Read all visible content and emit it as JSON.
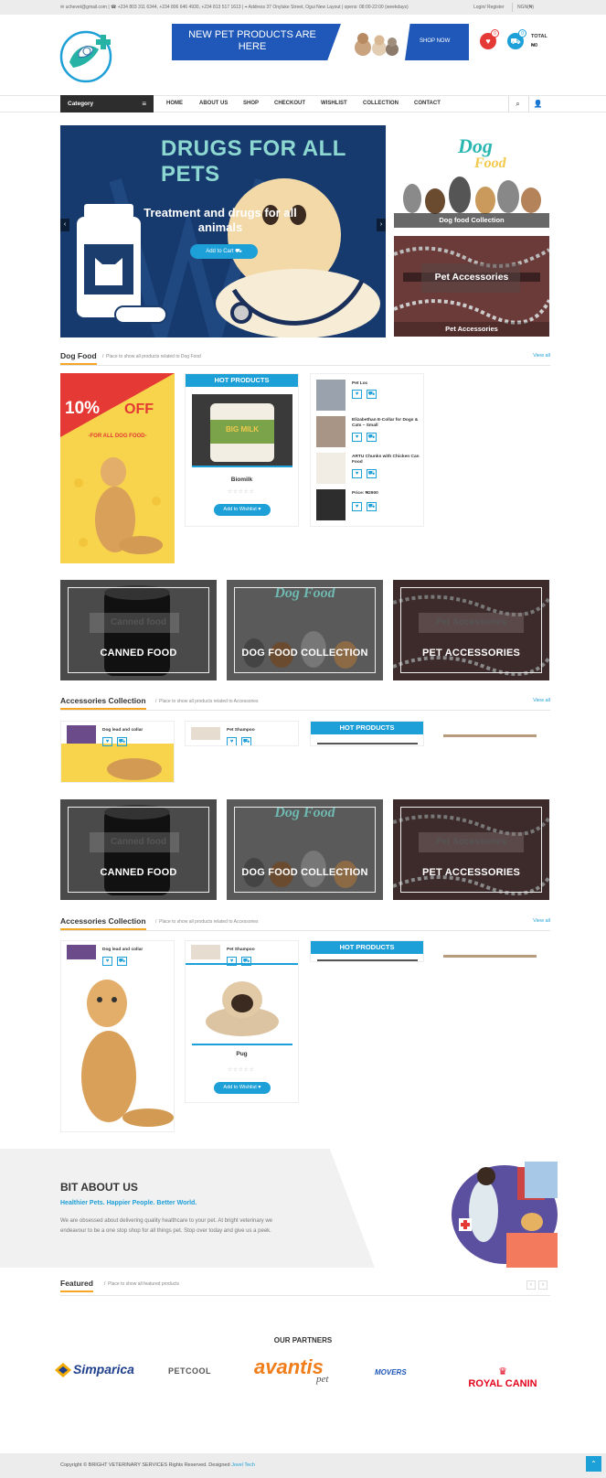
{
  "topbar": {
    "email": "uchevet@gmail.com",
    "phones": "+234 803 311 6344, +234 806 646 4930, +234 813 517 1613",
    "address": "Address 37 Onyluke Street, Ogui New Layout | opens: 08:00-22:00 (weekdays)",
    "login": "Login/ Register",
    "currency": "NGN(₦)"
  },
  "header": {
    "banner_left": "NEW PET PRODUCTS ARE HERE",
    "banner_right": "SHOP NOW",
    "wishlist_count": "0",
    "cart_count": "0",
    "total_label": "TOTAL",
    "total_value": "₦0"
  },
  "nav": {
    "category": "Category",
    "items": [
      "HOME",
      "ABOUT US",
      "SHOP",
      "CHECKOUT",
      "WISHLIST",
      "COLLECTION",
      "CONTACT"
    ]
  },
  "hero": {
    "title": "DRUGS FOR ALL PETS",
    "subtitle": "Treatment and drugs for all animals",
    "cta": "Add to Cart",
    "side1": "Dog food Collection",
    "side2_overlay": "Pet Accessories",
    "side2": "Pet Accessories"
  },
  "dogfood": {
    "title": "Dog Food",
    "desc": "Place to show all products related to Dog Food",
    "viewall": "View all",
    "promo_pct": "10%",
    "promo_off": "OFF",
    "promo_sub": "-FOR ALL DOG FOOD-",
    "hot": "HOT PRODUCTS",
    "hot_product": "Biomilk",
    "hot_product_jar": "BIG MILK",
    "wishlist": "Add to Wishlist ♥",
    "list": [
      {
        "name": "Pet Loc"
      },
      {
        "name": "Elizabethan E-Collar for Dogs & Cats – Small"
      },
      {
        "name": "ARTU Chunks with Chicken Can Food"
      },
      {
        "name": "Price: ₦2900"
      }
    ]
  },
  "tiles": {
    "canned": "CANNED FOOD",
    "canned_overlay": "Canned food",
    "dogfood": "DOG FOOD COLLECTION",
    "dogfood_overlay": "Dog Food",
    "accessories": "PET ACCESSORIES",
    "accessories_overlay": "Pet Accessories"
  },
  "acc1": {
    "title": "Accessories Collection",
    "desc": "Place to show all products related to Accessories",
    "viewall": "View all",
    "item1": "Dog lead and collar",
    "item2": "Pet Shampoo",
    "hot": "HOT PRODUCTS"
  },
  "acc2": {
    "title": "Accessories Collection",
    "desc": "Place to show all products related to Accessories",
    "viewall": "View all",
    "item1": "Dog lead and collar",
    "item2": "Pet Shampoo",
    "hot": "HOT PRODUCTS",
    "hot_product": "Pug",
    "wishlist": "Add to Wishlist ♥"
  },
  "about": {
    "title": "BIT ABOUT US",
    "tagline": "Healthier Pets. Happier People. Better World.",
    "body": "We are obsessed about delivering quality healthcare to your pet. At bright veterinary we endeavour to be a one stop shop for all things pet. Stop over today and give us a peek."
  },
  "featured": {
    "title": "Featured",
    "desc": "Place to show all featured products"
  },
  "partners": {
    "title": "OUR PARTNERS",
    "logos": [
      "Simparica",
      "PETCOOL",
      "avantis",
      "pet",
      "MOVERS",
      "ROYAL CANIN"
    ]
  },
  "footer": {
    "copyright": "Copyright © BRIGHT VETERINARY SERVICES Rights Reserved. Designed",
    "designer": "Jovel Tech"
  },
  "colors": {
    "accent": "#1d9fd8",
    "dark": "#2d2d2d",
    "orange": "#f5a623",
    "red": "#e53935"
  }
}
